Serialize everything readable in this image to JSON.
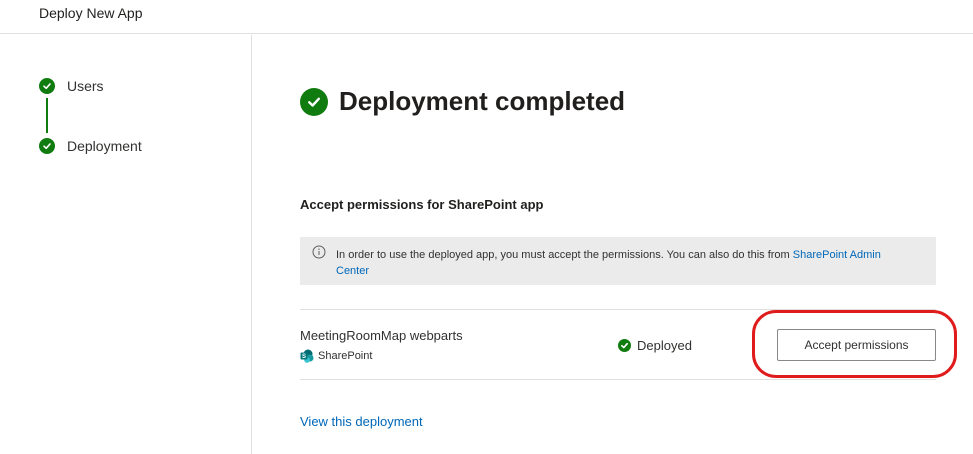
{
  "header": {
    "title": "Deploy New App"
  },
  "stepper": {
    "steps": [
      {
        "label": "Users",
        "status": "complete"
      },
      {
        "label": "Deployment",
        "status": "complete"
      }
    ]
  },
  "main": {
    "title": "Deployment completed",
    "section_title": "Accept permissions for SharePoint app",
    "info": {
      "text": "In order to use the deployed app, you must accept the permissions. You can also do this from ",
      "link_text": "SharePoint Admin Center"
    },
    "app": {
      "name": "MeetingRoomMap webparts",
      "source": "SharePoint",
      "status": "Deployed",
      "action_label": "Accept permissions"
    },
    "view_link": "View this deployment"
  },
  "colors": {
    "success": "#107c10",
    "link": "#0067b8",
    "info_bg": "#ebebeb",
    "highlight": "#e01b1b",
    "sharepoint": "#038387"
  },
  "icons": {
    "step": "checkmark-circle-icon",
    "title": "checkmark-circle-icon",
    "info": "info-icon",
    "source": "sharepoint-icon",
    "status": "checkmark-circle-icon"
  }
}
